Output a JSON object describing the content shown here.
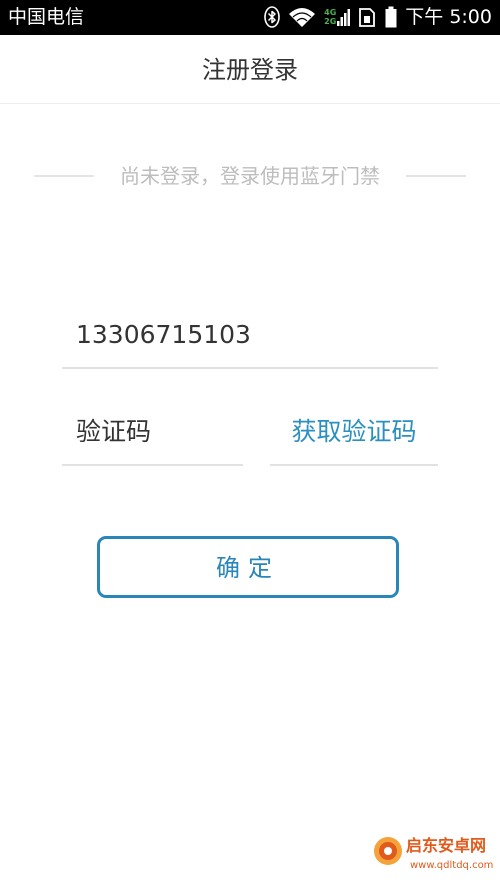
{
  "status_bar": {
    "carrier": "中国电信",
    "network_top": "4G",
    "network_bottom": "2G",
    "time": "下午 5:00",
    "icons": [
      "bluetooth-icon",
      "wifi-icon",
      "signal-icon",
      "sim-icon",
      "battery-icon"
    ]
  },
  "header": {
    "title": "注册登录"
  },
  "login_hint": "尚未登录，登录使用蓝牙门禁",
  "form": {
    "phone_value": "13306715103",
    "code_placeholder": "验证码",
    "get_code_label": "获取验证码",
    "confirm_label": "确定"
  },
  "watermark": {
    "title": "启东安卓网",
    "url": "www.qdltdq.com"
  },
  "colors": {
    "accent": "#2a86b8",
    "link": "#2b8fbf",
    "hint_text": "#bdbdbd",
    "divider": "#e2e2e2",
    "watermark": "#e05a1c"
  }
}
